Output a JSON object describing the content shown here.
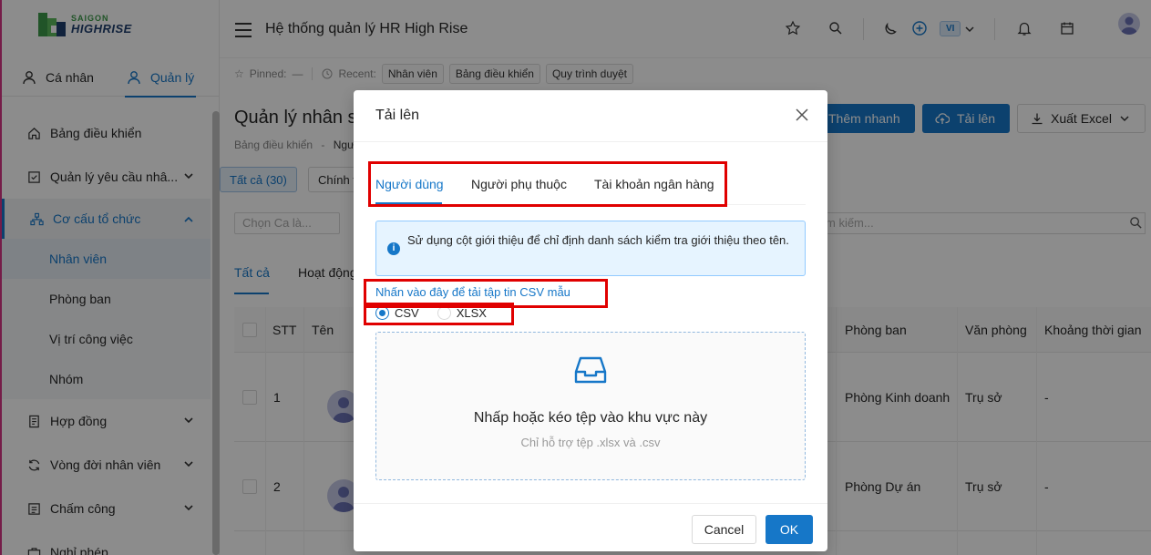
{
  "brand": {
    "line1": "SAIGON",
    "line2": "HIGHRISE"
  },
  "modes": {
    "personal": "Cá nhân",
    "manage": "Quản lý"
  },
  "menu": {
    "dashboard": "Bảng điều khiển",
    "requests": "Quản lý yêu cầu nhâ...",
    "org": "Cơ cấu tổ chức",
    "employees": "Nhân viên",
    "departments": "Phòng ban",
    "positions": "Vị trí công việc",
    "groups": "Nhóm",
    "contracts": "Hợp đồng",
    "lifecycle": "Vòng đời nhân viên",
    "attendance": "Chấm công",
    "leave": "Nghỉ phép"
  },
  "header": {
    "title": "Hệ thống quản lý HR High Rise",
    "lang": "VI"
  },
  "recent": {
    "pinned_label": "Pinned:",
    "pinned_value": "—",
    "recent_label": "Recent:",
    "chips": [
      "Nhân viên",
      "Bảng điều khiển",
      "Quy trình duyệt"
    ]
  },
  "page": {
    "title": "Quản lý nhân s",
    "breadcrumb_root": "Bảng điều khiển",
    "breadcrumb_sep": "-",
    "breadcrumb_current": "Ngư",
    "add_quick": "Thêm nhanh",
    "upload": "Tải lên",
    "export": "Xuất Excel",
    "filter_all": "Tất cả (30)",
    "filter_official": "Chính t",
    "shift_placeholder": "Chọn Ca là...",
    "search_placeholder": "m kiếm...",
    "subtab_all": "Tất cả",
    "subtab_active": "Hoạt động"
  },
  "table": {
    "headers": {
      "stt": "STT",
      "name": "Tên",
      "department": "Phòng ban",
      "office": "Văn phòng",
      "period": "Khoảng thời gian"
    },
    "rows": [
      {
        "stt": "1",
        "department": "Phòng Kinh doanh",
        "office": "Trụ sở",
        "period": "-"
      },
      {
        "stt": "2",
        "department": "Phòng Dự án",
        "office": "Trụ sở",
        "period": "-"
      }
    ]
  },
  "modal": {
    "title": "Tải lên",
    "tabs": [
      "Người dùng",
      "Người phụ thuộc",
      "Tài khoản ngân hàng"
    ],
    "info": "Sử dụng cột giới thiệu để chỉ định danh sách kiểm tra giới thiệu theo tên.",
    "csv_link": "Nhấn vào đây để tải tập tin CSV mẫu",
    "format_csv": "CSV",
    "format_xlsx": "XLSX",
    "selected_format": "CSV",
    "drop_text": "Nhấp hoặc kéo tệp vào khu vực này",
    "drop_hint": "Chỉ hỗ trợ tệp .xlsx và .csv",
    "cancel": "Cancel",
    "ok": "OK"
  },
  "colors": {
    "primary": "#1677c8",
    "highlight": "#e00000",
    "info_bg": "#e6f4ff"
  }
}
